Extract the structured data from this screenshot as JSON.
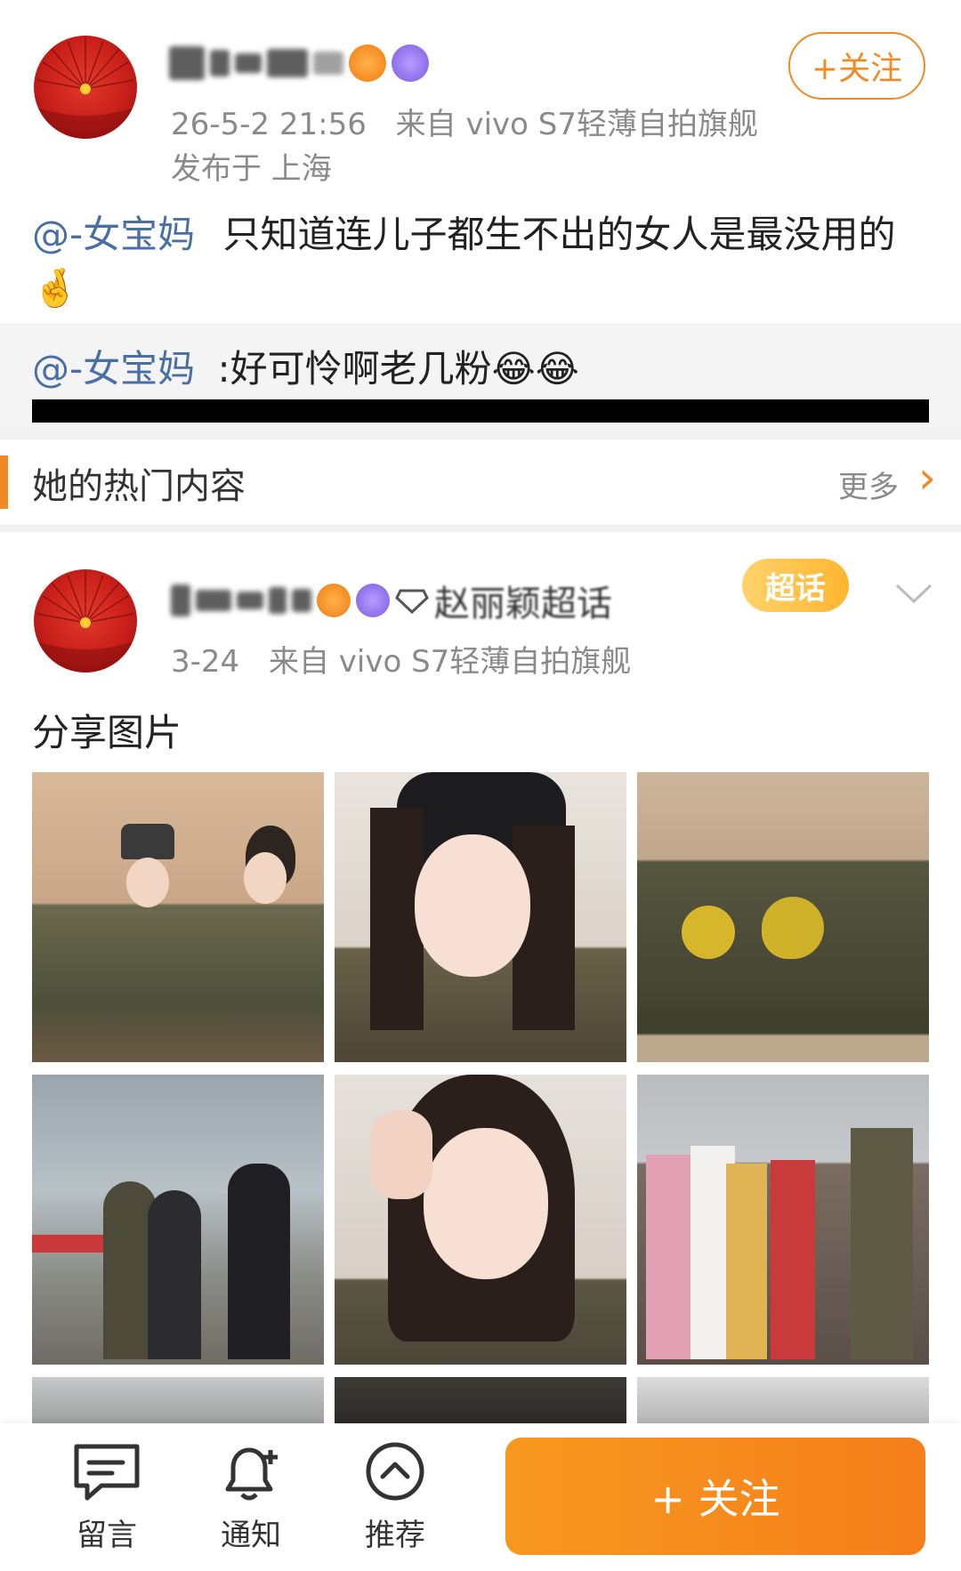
{
  "post1": {
    "timestamp": "26-5-2 21:56",
    "source": "来自 vivo S7轻薄自拍旗舰",
    "location": "发布于 上海",
    "mention": "@-女宝妈",
    "text": "只知道连儿子都生不出的女人是最没用的",
    "hand_emoji": "🤞"
  },
  "follow_button": {
    "label": "+关注"
  },
  "quote": {
    "mention": "@-女宝妈",
    "text": ":好可怜啊老几粉",
    "emoji": "😂😂"
  },
  "hot_section": {
    "title": "她的热门内容",
    "more_label": "更多",
    "chevron": "›"
  },
  "post2": {
    "topic": "赵丽颖超话",
    "super_badge": "超话",
    "timestamp": "3-24",
    "source": "来自 vivo S7轻薄自拍旗舰",
    "text": "分享图片"
  },
  "images": [
    {
      "name": "camo-two-women"
    },
    {
      "name": "camo-selfie-cap"
    },
    {
      "name": "camo-group-pompoms"
    },
    {
      "name": "airport-walk"
    },
    {
      "name": "peace-sign-selfie"
    },
    {
      "name": "fans-crowd"
    }
  ],
  "bottom_bar": {
    "comment_label": "留言",
    "notify_label": "通知",
    "recommend_label": "推荐",
    "follow_label": "+ 关注"
  },
  "colors": {
    "accent": "#f08a24",
    "mention": "#4a6fa5",
    "meta": "#8a8a8a"
  }
}
